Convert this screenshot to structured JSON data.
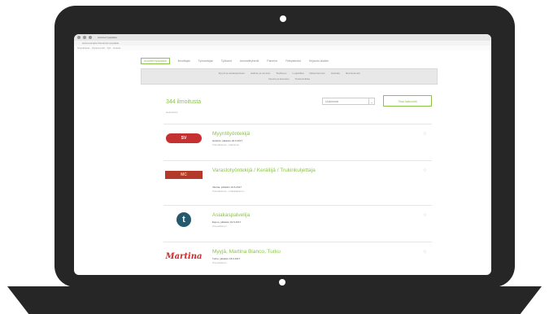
{
  "browser": {
    "tab_title": "Avoimet työpaikat",
    "address": "www.example.fi/avoimet-tyopaikat",
    "bookmarks": "Sovellukset · Kirjanmerkit · Työ · Uutiset"
  },
  "topnav": [
    {
      "label": "Avoimet työpaikat",
      "active": true
    },
    {
      "label": "Ilmoittajat"
    },
    {
      "label": "Työnantajat"
    },
    {
      "label": "Työkalut"
    },
    {
      "label": "Ammattiryhmät"
    },
    {
      "label": "Palvelut"
    },
    {
      "label": "Yhteystiedot"
    },
    {
      "label": "Kirjaudu sisään"
    }
  ],
  "subnav": {
    "row1": [
      "Myynti ja asiakaspalvelu",
      "Hallinto ja toimisto",
      "Teollisuus",
      "Logistiikka",
      "Rakentaminen",
      "Hoitoala",
      "Ravintola-ala"
    ],
    "row2": [
      "Opetus ja kasvatus",
      "Tietotekniikka"
    ]
  },
  "results": {
    "count": "344 ilmoitusta",
    "sub": "Hakuehdot"
  },
  "sort": {
    "select": "Uusimmat",
    "button": "⌄",
    "alert_button": "Tilaa hakuvahti"
  },
  "listings": [
    {
      "logo": "SV",
      "title": "Myyntityöntekijä",
      "meta": "Helsinki, julkaistu 20.6.2017",
      "loc": "Kokoaikainen, vakituinen"
    },
    {
      "logo": "MC",
      "title": "Varastotyöntekijä / Keräilijä / Trukinkuljettaja",
      "meta": "Vantaa, julkaistu 19.6.2017",
      "loc": "Kokoaikainen, määräaikainen"
    },
    {
      "logo": "t",
      "title": "Asiakaspalvelija",
      "meta": "Espoo, julkaistu 19.6.2017",
      "loc": "Osa-aikainen"
    },
    {
      "logo": "Martina",
      "title": "Myyjä, Martina Bianco, Turku",
      "meta": "Turku, julkaistu 18.6.2017",
      "loc": "Osa-aikainen"
    }
  ]
}
